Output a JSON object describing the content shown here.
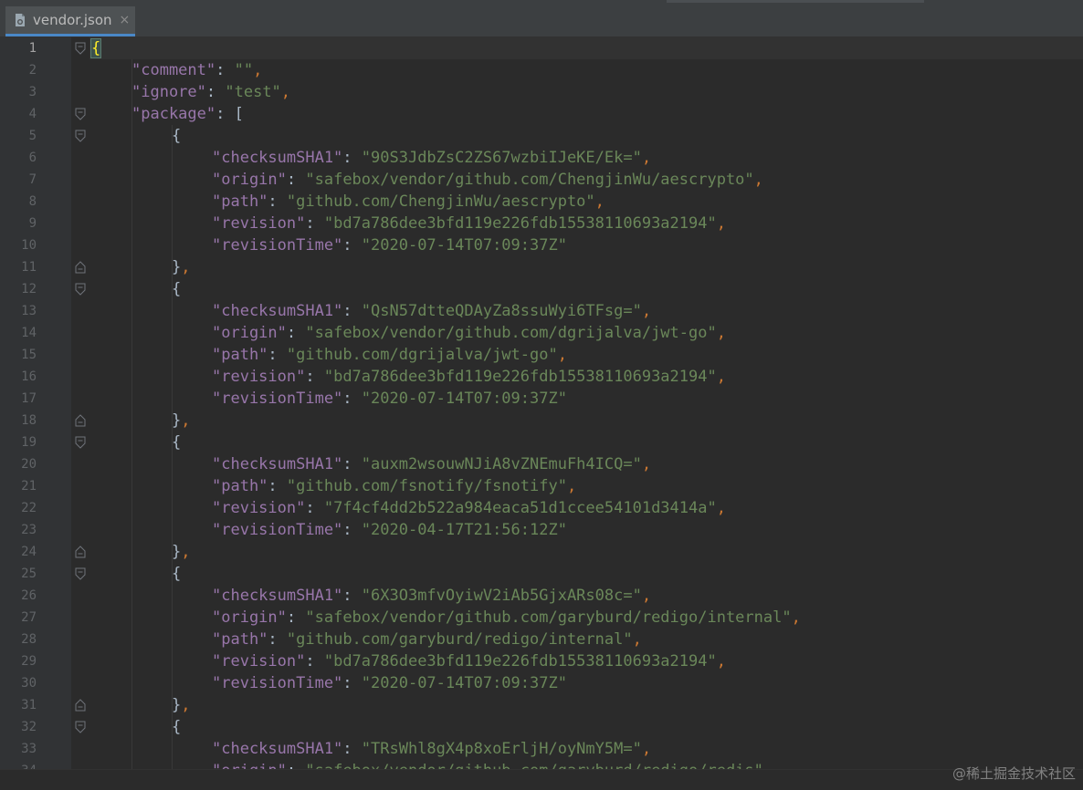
{
  "tab": {
    "filename": "vendor.json",
    "close_glyph": "×",
    "icon": "json-file-icon"
  },
  "editor": {
    "current_line": 1,
    "lines": [
      {
        "n": "1",
        "indent": 0,
        "tokens": [
          {
            "t": "{",
            "c": "bhl"
          }
        ]
      },
      {
        "n": "2",
        "indent": 1,
        "tokens": [
          {
            "t": "\"comment\"",
            "c": "k"
          },
          {
            "t": ": ",
            "c": "b"
          },
          {
            "t": "\"\"",
            "c": "s"
          },
          {
            "t": ",",
            "c": "p"
          }
        ]
      },
      {
        "n": "3",
        "indent": 1,
        "tokens": [
          {
            "t": "\"ignore\"",
            "c": "k"
          },
          {
            "t": ": ",
            "c": "b"
          },
          {
            "t": "\"test\"",
            "c": "s"
          },
          {
            "t": ",",
            "c": "p"
          }
        ]
      },
      {
        "n": "4",
        "indent": 1,
        "tokens": [
          {
            "t": "\"package\"",
            "c": "k"
          },
          {
            "t": ": [",
            "c": "b"
          }
        ]
      },
      {
        "n": "5",
        "indent": 2,
        "tokens": [
          {
            "t": "{",
            "c": "b"
          }
        ]
      },
      {
        "n": "6",
        "indent": 3,
        "tokens": [
          {
            "t": "\"checksumSHA1\"",
            "c": "k"
          },
          {
            "t": ": ",
            "c": "b"
          },
          {
            "t": "\"90S3JdbZsC2ZS67wzbiIJeKE/Ek=\"",
            "c": "s"
          },
          {
            "t": ",",
            "c": "p"
          }
        ]
      },
      {
        "n": "7",
        "indent": 3,
        "tokens": [
          {
            "t": "\"origin\"",
            "c": "k"
          },
          {
            "t": ": ",
            "c": "b"
          },
          {
            "t": "\"safebox/vendor/github.com/ChengjinWu/aescrypto\"",
            "c": "s"
          },
          {
            "t": ",",
            "c": "p"
          }
        ]
      },
      {
        "n": "8",
        "indent": 3,
        "tokens": [
          {
            "t": "\"path\"",
            "c": "k"
          },
          {
            "t": ": ",
            "c": "b"
          },
          {
            "t": "\"github.com/ChengjinWu/aescrypto\"",
            "c": "s"
          },
          {
            "t": ",",
            "c": "p"
          }
        ]
      },
      {
        "n": "9",
        "indent": 3,
        "tokens": [
          {
            "t": "\"revision\"",
            "c": "k"
          },
          {
            "t": ": ",
            "c": "b"
          },
          {
            "t": "\"bd7a786dee3bfd119e226fdb15538110693a2194\"",
            "c": "s"
          },
          {
            "t": ",",
            "c": "p"
          }
        ]
      },
      {
        "n": "10",
        "indent": 3,
        "tokens": [
          {
            "t": "\"revisionTime\"",
            "c": "k"
          },
          {
            "t": ": ",
            "c": "b"
          },
          {
            "t": "\"2020-07-14T07:09:37Z\"",
            "c": "s"
          }
        ]
      },
      {
        "n": "11",
        "indent": 2,
        "tokens": [
          {
            "t": "}",
            "c": "b"
          },
          {
            "t": ",",
            "c": "p"
          }
        ]
      },
      {
        "n": "12",
        "indent": 2,
        "tokens": [
          {
            "t": "{",
            "c": "b"
          }
        ]
      },
      {
        "n": "13",
        "indent": 3,
        "tokens": [
          {
            "t": "\"checksumSHA1\"",
            "c": "k"
          },
          {
            "t": ": ",
            "c": "b"
          },
          {
            "t": "\"QsN57dtteQDAyZa8ssuWyi6TFsg=\"",
            "c": "s"
          },
          {
            "t": ",",
            "c": "p"
          }
        ]
      },
      {
        "n": "14",
        "indent": 3,
        "tokens": [
          {
            "t": "\"origin\"",
            "c": "k"
          },
          {
            "t": ": ",
            "c": "b"
          },
          {
            "t": "\"safebox/vendor/github.com/dgrijalva/jwt-go\"",
            "c": "s"
          },
          {
            "t": ",",
            "c": "p"
          }
        ]
      },
      {
        "n": "15",
        "indent": 3,
        "tokens": [
          {
            "t": "\"path\"",
            "c": "k"
          },
          {
            "t": ": ",
            "c": "b"
          },
          {
            "t": "\"github.com/dgrijalva/jwt-go\"",
            "c": "s"
          },
          {
            "t": ",",
            "c": "p"
          }
        ]
      },
      {
        "n": "16",
        "indent": 3,
        "tokens": [
          {
            "t": "\"revision\"",
            "c": "k"
          },
          {
            "t": ": ",
            "c": "b"
          },
          {
            "t": "\"bd7a786dee3bfd119e226fdb15538110693a2194\"",
            "c": "s"
          },
          {
            "t": ",",
            "c": "p"
          }
        ]
      },
      {
        "n": "17",
        "indent": 3,
        "tokens": [
          {
            "t": "\"revisionTime\"",
            "c": "k"
          },
          {
            "t": ": ",
            "c": "b"
          },
          {
            "t": "\"2020-07-14T07:09:37Z\"",
            "c": "s"
          }
        ]
      },
      {
        "n": "18",
        "indent": 2,
        "tokens": [
          {
            "t": "}",
            "c": "b"
          },
          {
            "t": ",",
            "c": "p"
          }
        ]
      },
      {
        "n": "19",
        "indent": 2,
        "tokens": [
          {
            "t": "{",
            "c": "b"
          }
        ]
      },
      {
        "n": "20",
        "indent": 3,
        "tokens": [
          {
            "t": "\"checksumSHA1\"",
            "c": "k"
          },
          {
            "t": ": ",
            "c": "b"
          },
          {
            "t": "\"auxm2wsouwNJiA8vZNEmuFh4ICQ=\"",
            "c": "s"
          },
          {
            "t": ",",
            "c": "p"
          }
        ]
      },
      {
        "n": "21",
        "indent": 3,
        "tokens": [
          {
            "t": "\"path\"",
            "c": "k"
          },
          {
            "t": ": ",
            "c": "b"
          },
          {
            "t": "\"github.com/fsnotify/fsnotify\"",
            "c": "s"
          },
          {
            "t": ",",
            "c": "p"
          }
        ]
      },
      {
        "n": "22",
        "indent": 3,
        "tokens": [
          {
            "t": "\"revision\"",
            "c": "k"
          },
          {
            "t": ": ",
            "c": "b"
          },
          {
            "t": "\"7f4cf4dd2b522a984eaca51d1ccee54101d3414a\"",
            "c": "s"
          },
          {
            "t": ",",
            "c": "p"
          }
        ]
      },
      {
        "n": "23",
        "indent": 3,
        "tokens": [
          {
            "t": "\"revisionTime\"",
            "c": "k"
          },
          {
            "t": ": ",
            "c": "b"
          },
          {
            "t": "\"2020-04-17T21:56:12Z\"",
            "c": "s"
          }
        ]
      },
      {
        "n": "24",
        "indent": 2,
        "tokens": [
          {
            "t": "}",
            "c": "b"
          },
          {
            "t": ",",
            "c": "p"
          }
        ]
      },
      {
        "n": "25",
        "indent": 2,
        "tokens": [
          {
            "t": "{",
            "c": "b"
          }
        ]
      },
      {
        "n": "26",
        "indent": 3,
        "tokens": [
          {
            "t": "\"checksumSHA1\"",
            "c": "k"
          },
          {
            "t": ": ",
            "c": "b"
          },
          {
            "t": "\"6X3O3mfvOyiwV2iAb5GjxARs08c=\"",
            "c": "s"
          },
          {
            "t": ",",
            "c": "p"
          }
        ]
      },
      {
        "n": "27",
        "indent": 3,
        "tokens": [
          {
            "t": "\"origin\"",
            "c": "k"
          },
          {
            "t": ": ",
            "c": "b"
          },
          {
            "t": "\"safebox/vendor/github.com/garyburd/redigo/internal\"",
            "c": "s"
          },
          {
            "t": ",",
            "c": "p"
          }
        ]
      },
      {
        "n": "28",
        "indent": 3,
        "tokens": [
          {
            "t": "\"path\"",
            "c": "k"
          },
          {
            "t": ": ",
            "c": "b"
          },
          {
            "t": "\"github.com/garyburd/redigo/internal\"",
            "c": "s"
          },
          {
            "t": ",",
            "c": "p"
          }
        ]
      },
      {
        "n": "29",
        "indent": 3,
        "tokens": [
          {
            "t": "\"revision\"",
            "c": "k"
          },
          {
            "t": ": ",
            "c": "b"
          },
          {
            "t": "\"bd7a786dee3bfd119e226fdb15538110693a2194\"",
            "c": "s"
          },
          {
            "t": ",",
            "c": "p"
          }
        ]
      },
      {
        "n": "30",
        "indent": 3,
        "tokens": [
          {
            "t": "\"revisionTime\"",
            "c": "k"
          },
          {
            "t": ": ",
            "c": "b"
          },
          {
            "t": "\"2020-07-14T07:09:37Z\"",
            "c": "s"
          }
        ]
      },
      {
        "n": "31",
        "indent": 2,
        "tokens": [
          {
            "t": "}",
            "c": "b"
          },
          {
            "t": ",",
            "c": "p"
          }
        ]
      },
      {
        "n": "32",
        "indent": 2,
        "tokens": [
          {
            "t": "{",
            "c": "b"
          }
        ]
      },
      {
        "n": "33",
        "indent": 3,
        "tokens": [
          {
            "t": "\"checksumSHA1\"",
            "c": "k"
          },
          {
            "t": ": ",
            "c": "b"
          },
          {
            "t": "\"TRsWhl8gX4p8xoErljH/oyNmY5M=\"",
            "c": "s"
          },
          {
            "t": ",",
            "c": "p"
          }
        ]
      },
      {
        "n": "34",
        "indent": 3,
        "tokens": [
          {
            "t": "\"origin\"",
            "c": "k"
          },
          {
            "t": ": ",
            "c": "b"
          },
          {
            "t": "\"safebox/vendor/github.com/garyburd/redigo/redis\"",
            "c": "s"
          },
          {
            "t": ",",
            "c": "p"
          }
        ]
      }
    ],
    "fold_markers": [
      {
        "line": 1,
        "kind": "open"
      },
      {
        "line": 4,
        "kind": "open"
      },
      {
        "line": 5,
        "kind": "open"
      },
      {
        "line": 11,
        "kind": "close"
      },
      {
        "line": 12,
        "kind": "open"
      },
      {
        "line": 18,
        "kind": "close"
      },
      {
        "line": 19,
        "kind": "open"
      },
      {
        "line": 24,
        "kind": "close"
      },
      {
        "line": 25,
        "kind": "open"
      },
      {
        "line": 31,
        "kind": "close"
      },
      {
        "line": 32,
        "kind": "open"
      }
    ]
  },
  "watermark": "@稀土掘金技术社区",
  "colors": {
    "background": "#2b2b2b",
    "key": "#9876aa",
    "string": "#6a8759",
    "punctuation": "#cc7832",
    "text": "#a9b7c6",
    "brace_highlight": "#ffef28"
  }
}
